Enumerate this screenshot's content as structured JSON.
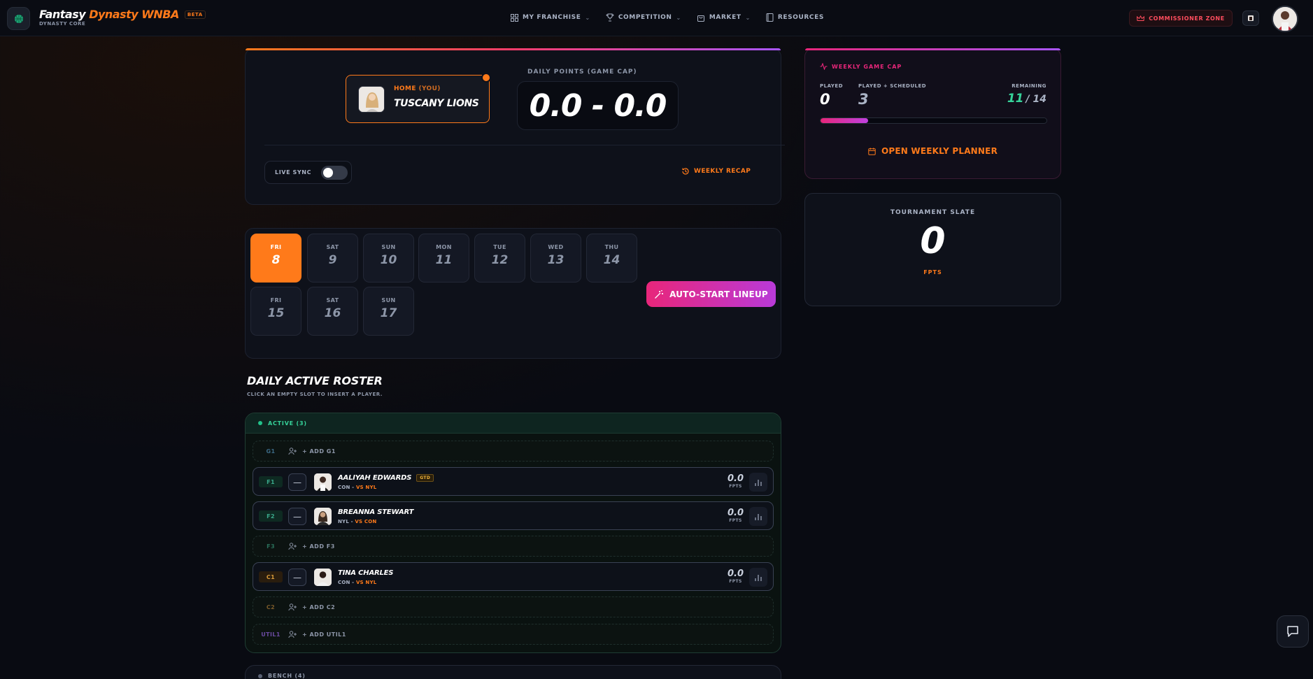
{
  "header": {
    "brand_a": "Fantasy",
    "brand_b": "Dynasty WNBA",
    "beta": "BETA",
    "subtitle": "DYNASTY CORE",
    "nav": [
      {
        "label": "MY FRANCHISE",
        "icon": "grid-icon"
      },
      {
        "label": "COMPETITION",
        "icon": "trophy-icon"
      },
      {
        "label": "MARKET",
        "icon": "bag-icon"
      },
      {
        "label": "RESOURCES",
        "icon": "book-icon"
      }
    ],
    "commissioner": "COMMISSIONER ZONE"
  },
  "matchup": {
    "home_label": "HOME",
    "you_label": "(YOU)",
    "team_name": "TUSCANY LIONS",
    "daily_points_label": "DAILY POINTS (GAME CAP)",
    "score": "0.0 - 0.0",
    "live_sync": "LIVE SYNC",
    "weekly_recap": "WEEKLY RECAP"
  },
  "days": [
    {
      "dow": "FRI",
      "date": "8",
      "active": true
    },
    {
      "dow": "SAT",
      "date": "9"
    },
    {
      "dow": "SUN",
      "date": "10"
    },
    {
      "dow": "MON",
      "date": "11"
    },
    {
      "dow": "TUE",
      "date": "12"
    },
    {
      "dow": "WED",
      "date": "13"
    },
    {
      "dow": "THU",
      "date": "14"
    },
    {
      "dow": "FRI",
      "date": "15"
    },
    {
      "dow": "SAT",
      "date": "16"
    },
    {
      "dow": "SUN",
      "date": "17"
    }
  ],
  "auto_start": "AUTO-START LINEUP",
  "roster": {
    "title": "DAILY ACTIVE ROSTER",
    "subtitle": "CLICK AN EMPTY SLOT TO INSERT A PLAYER.",
    "active_label": "ACTIVE (3)",
    "bench_label": "BENCH (4)",
    "fpts_label": "FPTS",
    "slots": [
      {
        "pos": "G1",
        "add": "+ ADD G1"
      },
      {
        "pos": "F1",
        "name": "AALIYAH EDWARDS",
        "badge": "GTD",
        "team": "CON -",
        "opp": "VS NYL",
        "fpts": "0.0"
      },
      {
        "pos": "F2",
        "name": "BREANNA STEWART",
        "team": "NYL -",
        "opp": "VS CON",
        "fpts": "0.0"
      },
      {
        "pos": "F3",
        "add": "+ ADD F3"
      },
      {
        "pos": "C1",
        "name": "TINA CHARLES",
        "team": "CON -",
        "opp": "VS NYL",
        "fpts": "0.0"
      },
      {
        "pos": "C2",
        "add": "+ ADD C2"
      },
      {
        "pos": "UTIL1",
        "add": "+ ADD UTIL1"
      }
    ]
  },
  "weekly_cap": {
    "title": "WEEKLY GAME CAP",
    "played_label": "PLAYED",
    "played": "0",
    "scheduled_label": "PLAYED + SCHEDULED",
    "scheduled": "3",
    "remaining_label": "REMAINING",
    "remaining": "11",
    "total": "/ 14",
    "progress_fraction": 0.21,
    "planner": "OPEN WEEKLY PLANNER"
  },
  "tournament": {
    "title": "TOURNAMENT SLATE",
    "value": "0",
    "unit": "FPTS"
  },
  "colors": {
    "accent_orange": "#ff7a1a",
    "accent_pink": "#e8267a",
    "accent_green": "#36d39a",
    "commissioner_red": "#ff4d5e"
  }
}
